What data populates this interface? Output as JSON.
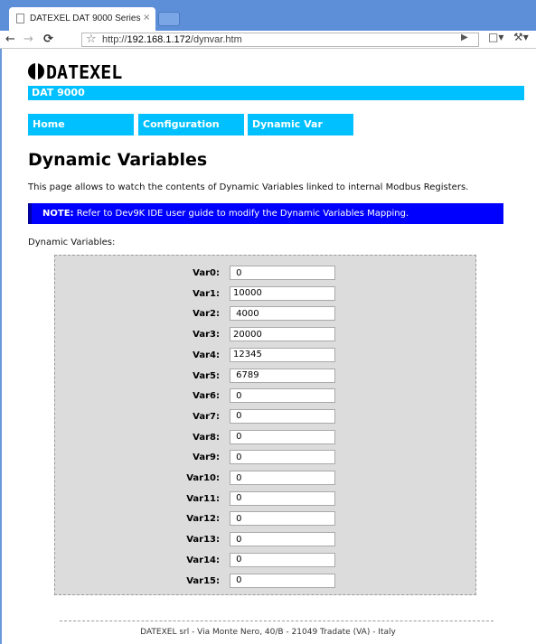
{
  "browser": {
    "tab_title": "DATEXEL DAT 9000 Series",
    "tab_close": "×",
    "url_prefix": "http://",
    "url_host": "192.168.1.172",
    "url_path": "/dynvar.htm"
  },
  "header": {
    "logo_text": "DATEXEL",
    "banner": "DAT 9000"
  },
  "nav": {
    "items": [
      "Home",
      "Configuration",
      "Dynamic Var"
    ]
  },
  "main": {
    "title": "Dynamic Variables",
    "intro": "This page allows to watch the contents of Dynamic Variables linked to internal Modbus Registers.",
    "note_label": "NOTE:",
    "note_text": " Refer to Dev9K IDE user guide to modify the Dynamic Variables Mapping.",
    "section_label": "Dynamic Variables:",
    "variables": [
      {
        "label": "Var0:",
        "value": " 0"
      },
      {
        "label": "Var1:",
        "value": "10000"
      },
      {
        "label": "Var2:",
        "value": " 4000"
      },
      {
        "label": "Var3:",
        "value": "20000"
      },
      {
        "label": "Var4:",
        "value": "12345"
      },
      {
        "label": "Var5:",
        "value": " 6789"
      },
      {
        "label": "Var6:",
        "value": " 0"
      },
      {
        "label": "Var7:",
        "value": " 0"
      },
      {
        "label": "Var8:",
        "value": " 0"
      },
      {
        "label": "Var9:",
        "value": " 0"
      },
      {
        "label": "Var10:",
        "value": " 0"
      },
      {
        "label": "Var11:",
        "value": " 0"
      },
      {
        "label": "Var12:",
        "value": " 0"
      },
      {
        "label": "Var13:",
        "value": " 0"
      },
      {
        "label": "Var14:",
        "value": " 0"
      },
      {
        "label": "Var15:",
        "value": " 0"
      }
    ]
  },
  "footer": {
    "text": "DATEXEL srl - Via Monte Nero, 40/B - 21049 Tradate (VA) - Italy"
  },
  "colors": {
    "accent": "#00c0ff",
    "note_bg": "#0000ff",
    "panel_bg": "#dcdcdc"
  }
}
